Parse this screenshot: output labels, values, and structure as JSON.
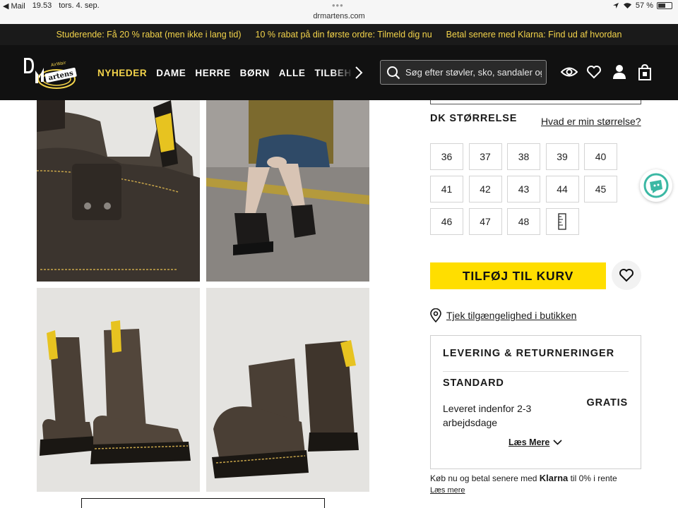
{
  "statusbar": {
    "back_app": "◀ Mail",
    "time": "19.53",
    "date": "tors. 4. sep.",
    "dots": "•••",
    "url": "drmartens.com",
    "battery": "57 %"
  },
  "promo": {
    "items": [
      "Studerende: Få 20 % rabat (men ikke i lang tid)",
      "10 % rabat på din første ordre: Tilmeld dig nu",
      "Betal senere med Klarna: Find ud af hvordan"
    ]
  },
  "header": {
    "logo_alt": "Dr. Martens AirWair",
    "nav": [
      "NYHEDER",
      "DAME",
      "HERRE",
      "BØRN",
      "ALLE",
      "TILBEHØR"
    ],
    "search_placeholder": "Søg efter støvler, sko, sandaler og mere",
    "icons": [
      "eye-icon",
      "heart-icon",
      "user-icon",
      "bag-icon"
    ]
  },
  "product": {
    "size_title": "DK STØRRELSE",
    "size_help": "Hvad er min størrelse?",
    "sizes": [
      "36",
      "37",
      "38",
      "39",
      "40",
      "41",
      "42",
      "43",
      "44",
      "45",
      "46",
      "47",
      "48"
    ],
    "add_to_cart": "TILFØJ TIL KURV",
    "store_check": "Tjek tilgængelighed i butikken"
  },
  "delivery": {
    "title": "LEVERING & RETURNERINGER",
    "standard": "STANDARD",
    "price": "GRATIS",
    "description": "Leveret indenfor 2-3 arbejdsdage",
    "read_more": "Læs Mere"
  },
  "klarna": {
    "text_before": "Køb nu og betal senere med",
    "brand": "Klarna",
    "text_after": "til 0% i rente",
    "link": "Læs mere"
  },
  "colors": {
    "promo_text": "#f3d34a",
    "header_bg": "#111111",
    "cart_button": "#ffde00",
    "chat_accent": "#3bb8a4"
  }
}
